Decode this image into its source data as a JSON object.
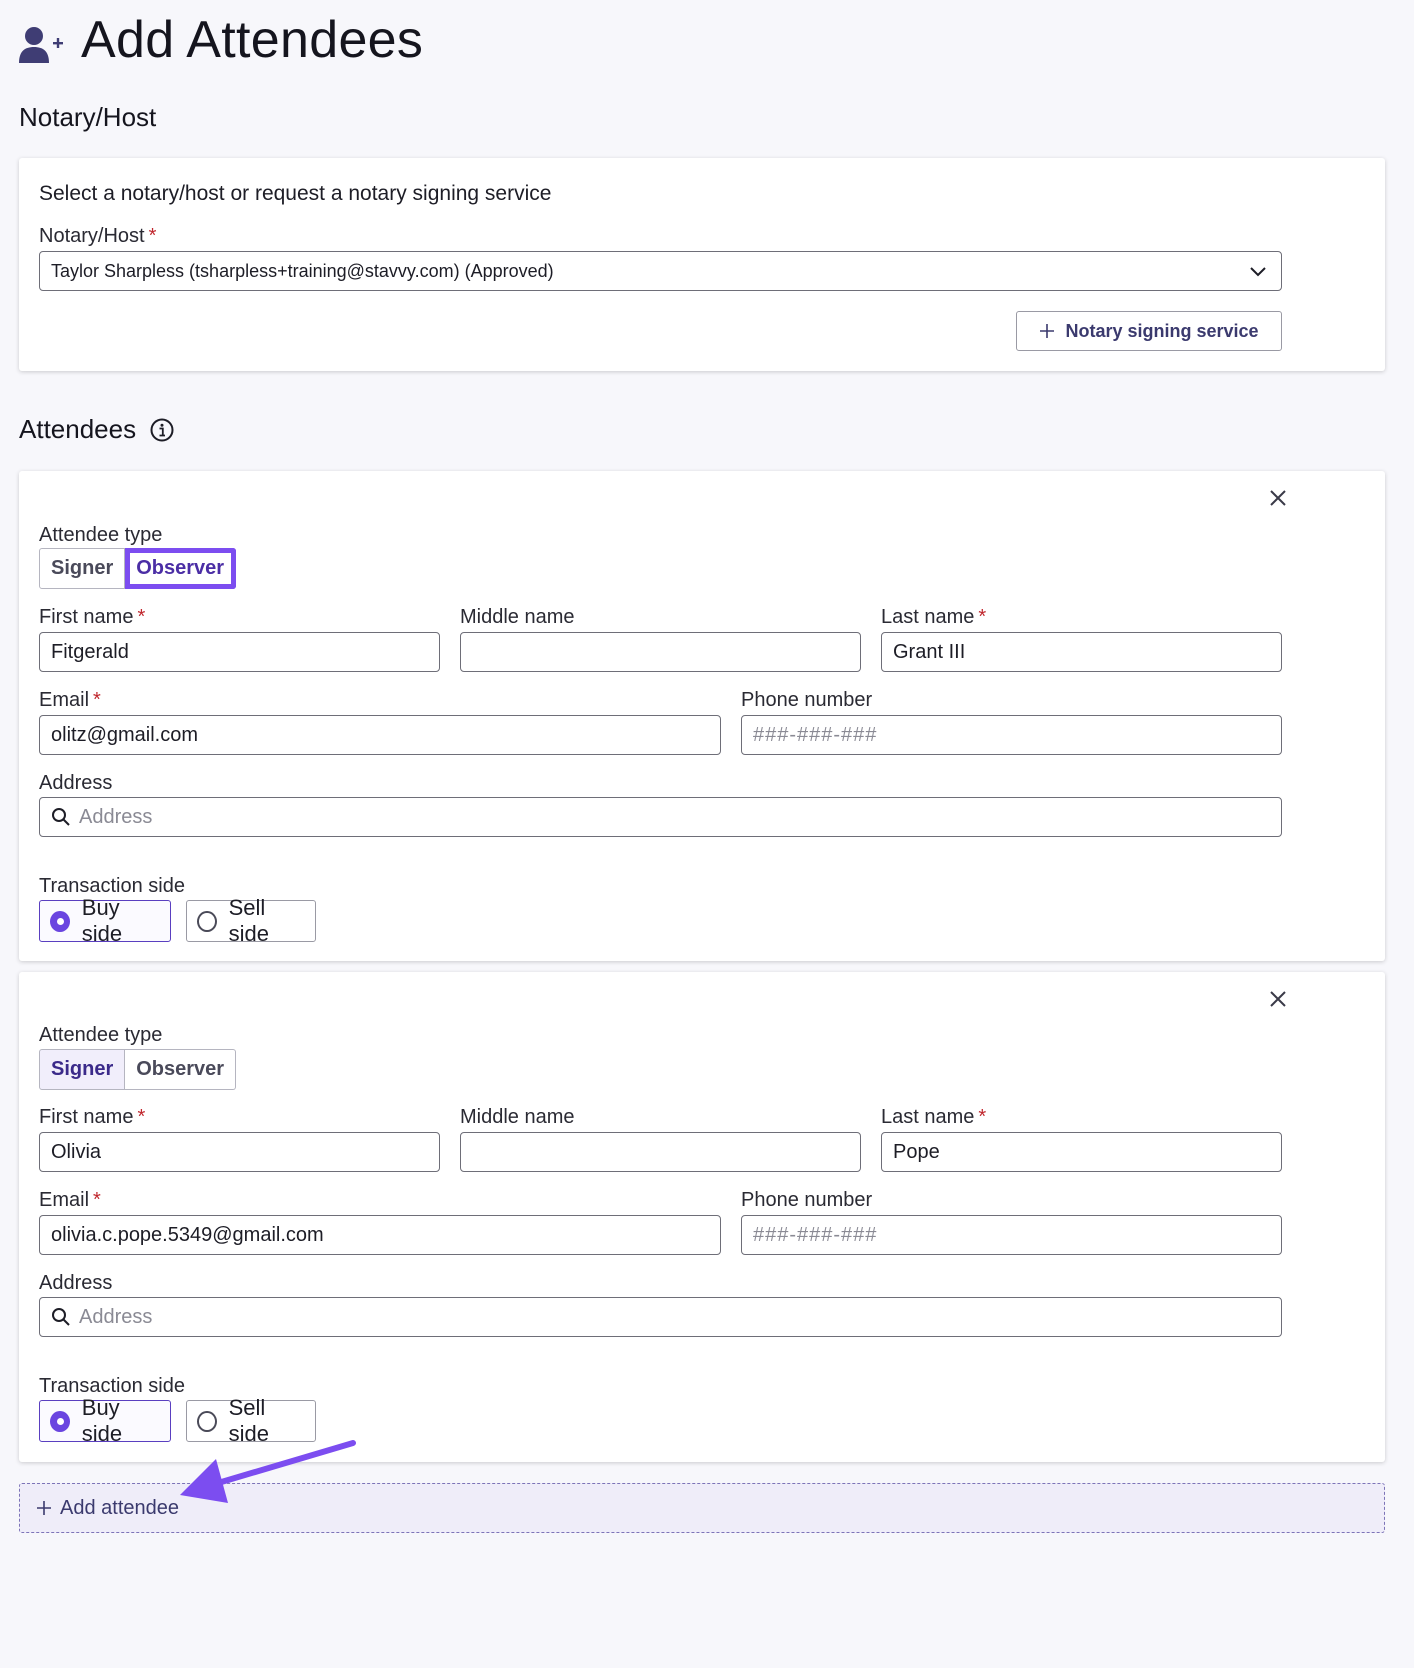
{
  "page": {
    "title": "Add Attendees"
  },
  "notary_section": {
    "heading": "Notary/Host",
    "description": "Select a notary/host or request a notary signing service",
    "field_label": "Notary/Host",
    "required_mark": "*",
    "selected_value": "Taylor Sharpless (tsharpless+training@stavvy.com) (Approved)",
    "service_button_label": "Notary signing service"
  },
  "attendees_section": {
    "heading": "Attendees"
  },
  "labels": {
    "attendee_type": "Attendee type",
    "first_name": "First name",
    "middle_name": "Middle name",
    "last_name": "Last name",
    "email": "Email",
    "phone": "Phone number",
    "address": "Address",
    "transaction_side": "Transaction side",
    "required_mark": "*",
    "signer": "Signer",
    "observer": "Observer",
    "buy_side": "Buy side",
    "sell_side": "Sell side",
    "phone_placeholder": "###-###-###",
    "address_placeholder": "Address"
  },
  "attendees": [
    {
      "type": "Observer",
      "first_name": "Fitgerald",
      "middle_name": "",
      "last_name": "Grant III",
      "email": "olitz@gmail.com",
      "phone": "",
      "address": "",
      "transaction_side": "Buy side"
    },
    {
      "type": "Signer",
      "first_name": "Olivia",
      "middle_name": "",
      "last_name": "Pope",
      "email": "olivia.c.pope.5349@gmail.com",
      "phone": "",
      "address": "",
      "transaction_side": "Buy side"
    }
  ],
  "add_attendee_label": "Add attendee",
  "colors": {
    "accent": "#7c4df0",
    "required": "#c0262d",
    "link": "#3b3a6e"
  },
  "icons": {
    "title": "user-plus-icon",
    "info": "info-icon",
    "close": "close-icon",
    "search": "search-icon",
    "chevron": "chevron-down-icon",
    "plus": "plus-icon"
  }
}
